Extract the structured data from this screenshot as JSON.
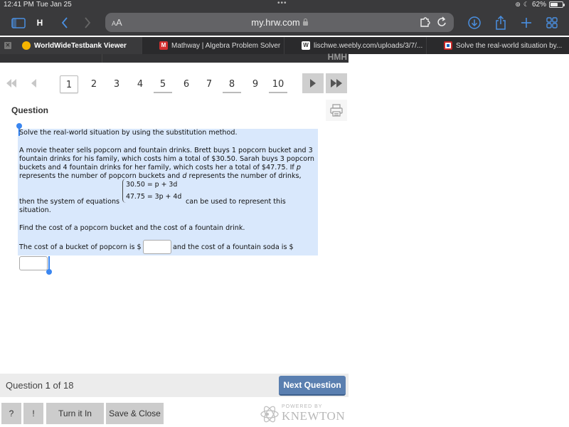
{
  "status_bar": {
    "time": "12:41 PM",
    "date": "Tue Jan 25",
    "battery": "62%",
    "battery_level": 0.62
  },
  "browser": {
    "tab_group_label": "H",
    "text_size_label": "AA",
    "url": "my.hrw.com",
    "tabs": [
      {
        "title": "WorldWideTestbank Viewer",
        "active": true,
        "favicon_color": "#f5b400"
      },
      {
        "title": "Mathway | Algebra Problem Solver",
        "active": false,
        "favicon_color": "#d32f2f"
      },
      {
        "title": "lischwe.weebly.com/uploads/3/7/...",
        "active": false,
        "favicon_color": "#ffffff"
      },
      {
        "title": "Solve the real-world situation by...",
        "active": false,
        "favicon_color": "#c62828"
      }
    ],
    "site_brand": "HMH"
  },
  "pager": {
    "pages": [
      "1",
      "2",
      "3",
      "4",
      "5",
      "6",
      "7",
      "8",
      "9",
      "10"
    ],
    "current": "1",
    "answered": [
      "5",
      "8",
      "10"
    ]
  },
  "question": {
    "heading": "Question",
    "instruction": "Solve the real-world situation by using the substitution method.",
    "problem_lines": [
      "A movie theater sells popcorn and fountain drinks. Brett buys 1 popcorn bucket and 3",
      "fountain drinks for his family, which costs him a total of $30.50. Sarah buys 3 popcorn",
      "buckets and 4 fountain drinks for her family, which costs her a total of $47.75. If"
    ],
    "var_p": "p",
    "line4_a": "represents the number of popcorn buckets and",
    "var_d": "d",
    "line4_b": "represents the number of drinks,",
    "system_prefix": "then the system of equations",
    "equation_1": "30.50 = p + 3d",
    "equation_2": "47.75 = 3p + 4d",
    "system_suffix": "can be used to represent this",
    "system_end": "situation.",
    "prompt": "Find the cost of a popcorn bucket and the cost of a fountain drink.",
    "answer_prefix": "The cost of a bucket of popcorn is $",
    "answer_middle": "and the cost of a fountain soda is $",
    "popcorn_value": "",
    "soda_value": ""
  },
  "footer": {
    "question_word": "Question",
    "question_index": "1",
    "question_total_text": "of 18",
    "next_label": "Next Question",
    "help_label": "?",
    "alert_label": "!",
    "turn_in_label": "Turn it In",
    "save_close_label": "Save & Close",
    "powered_by": "POWERED BY",
    "brand": "KNEWTON"
  },
  "colors": {
    "accent_blue": "#4a90e2",
    "selection": "#d9e8fc",
    "next_button": "#5a7fb0"
  }
}
